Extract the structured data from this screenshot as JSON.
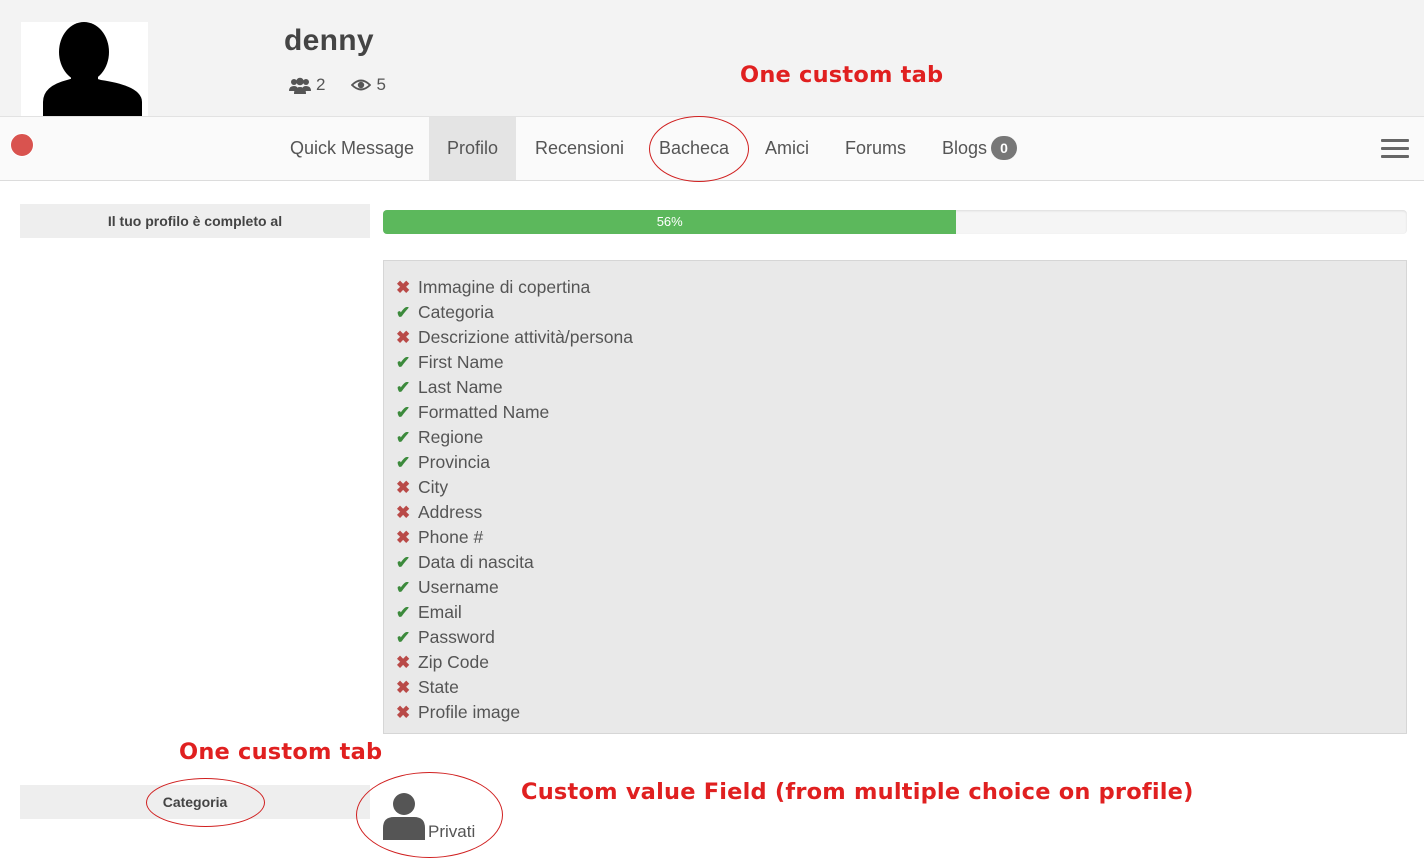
{
  "profile": {
    "username": "denny",
    "stats": {
      "friends": "2",
      "views": "5"
    }
  },
  "tabs": [
    {
      "label": "Quick Message"
    },
    {
      "label": "Profilo",
      "active": true
    },
    {
      "label": "Recensioni"
    },
    {
      "label": "Bacheca"
    },
    {
      "label": "Amici"
    },
    {
      "label": "Forums"
    },
    {
      "label": "Blogs",
      "badge": "0"
    }
  ],
  "completeness": {
    "label": "Il tuo profilo è completo al",
    "percent_text": "56%",
    "percent": 56
  },
  "checklist": [
    {
      "label": "Immagine di copertina",
      "done": false
    },
    {
      "label": "Categoria",
      "done": true
    },
    {
      "label": "Descrizione attività/persona",
      "done": false
    },
    {
      "label": "First Name",
      "done": true
    },
    {
      "label": "Last Name",
      "done": true
    },
    {
      "label": "Formatted Name",
      "done": true
    },
    {
      "label": "Regione",
      "done": true
    },
    {
      "label": "Provincia",
      "done": true
    },
    {
      "label": "City",
      "done": false
    },
    {
      "label": "Address",
      "done": false
    },
    {
      "label": "Phone #",
      "done": false
    },
    {
      "label": "Data di nascita",
      "done": true
    },
    {
      "label": "Username",
      "done": true
    },
    {
      "label": "Email",
      "done": true
    },
    {
      "label": "Password",
      "done": true
    },
    {
      "label": "Zip Code",
      "done": false
    },
    {
      "label": "State",
      "done": false
    },
    {
      "label": "Profile image",
      "done": false
    }
  ],
  "categoria": {
    "label": "Categoria",
    "value": "Privati"
  },
  "annotations": {
    "top": "One custom tab",
    "bottom": "One custom tab",
    "field": "Custom value Field (from multiple choice on profile)"
  },
  "colors": {
    "progress": "#5cb85c",
    "check": "#3c8a3c",
    "cross": "#b94a48",
    "status_offline": "#d9534f",
    "annotation": "#e02020"
  }
}
